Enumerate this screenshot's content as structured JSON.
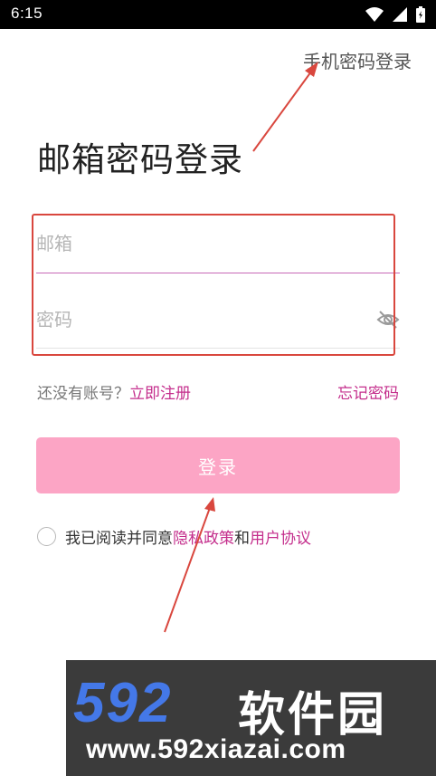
{
  "status_bar": {
    "time": "6:15",
    "icons": [
      "wifi-icon",
      "signal-icon",
      "battery-icon"
    ]
  },
  "header": {
    "switch_link": "手机密码登录"
  },
  "title": "邮箱密码登录",
  "form": {
    "email_placeholder": "邮箱",
    "password_placeholder": "密码",
    "password_toggle_icon": "eye-off-icon",
    "no_account_text": "还没有账号？",
    "register_link": "立即注册",
    "forgot_link": "忘记密码",
    "login_button": "登录"
  },
  "agreement": {
    "prefix": "我已阅读并同意",
    "privacy_link": "隐私政策",
    "conjunction": "和",
    "terms_link": "用户协议"
  },
  "watermark": {
    "logo": "592",
    "name": "软件园",
    "url": "www.592xiazai.com"
  },
  "colors": {
    "accent": "#c42e8c",
    "button_bg": "#fca5c5",
    "annotation": "#d9473e"
  }
}
